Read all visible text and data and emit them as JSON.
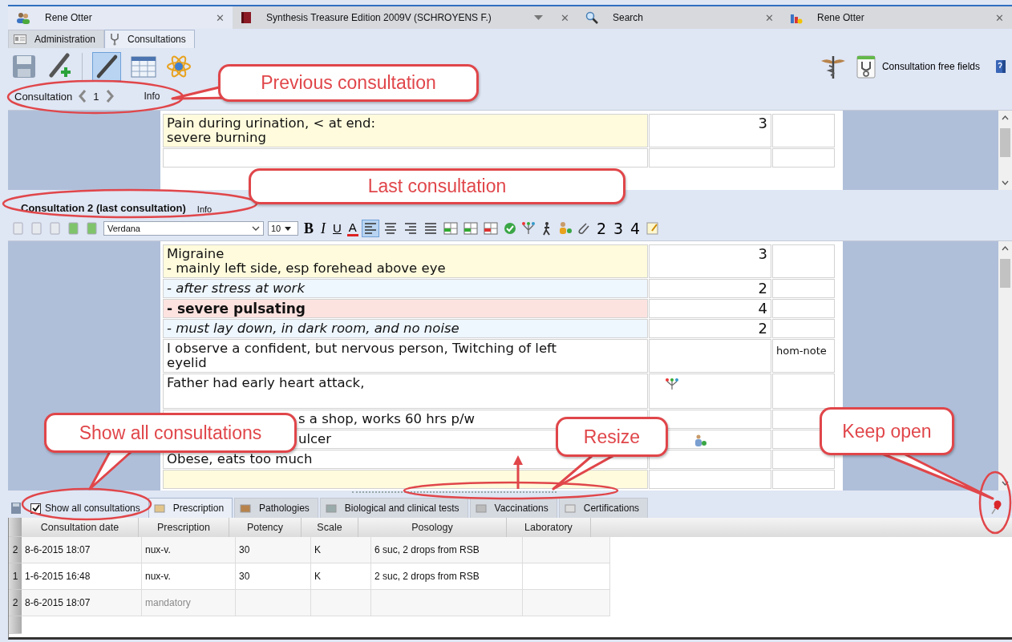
{
  "document_tabs": [
    {
      "title": "Rene Otter",
      "close": "✕",
      "selected": true,
      "has_menu": false
    },
    {
      "title": "Synthesis Treasure Edition 2009V (SCHROYENS F.)",
      "close": "✕",
      "selected": false,
      "has_menu": true
    },
    {
      "title": "Search",
      "close": "✕",
      "selected": false,
      "has_menu": false
    },
    {
      "title": "Rene Otter",
      "close": "✕",
      "selected": false,
      "has_menu": false
    }
  ],
  "record_tabs": [
    {
      "label": "Administration",
      "selected": false
    },
    {
      "label": "Consultations",
      "selected": true
    }
  ],
  "toolbar": {
    "free_fields": "Consultation free fields"
  },
  "navigator": {
    "label": "Consultation",
    "number": "1",
    "info": "Info"
  },
  "previous_consultation": {
    "rows": [
      {
        "lines": [
          "Pain during urination, < at end:",
          "severe burning"
        ],
        "weight": "3",
        "color": "#fffbdc"
      },
      {
        "color": "#ffffff"
      }
    ]
  },
  "last_consultation": {
    "title": "Consultation 2 (last consultation)",
    "info": "Info",
    "font": "Verdana",
    "size": "10",
    "format_buttons": [
      "B",
      "I",
      "U",
      "A"
    ],
    "number_buttons": [
      "2",
      "3",
      "4"
    ],
    "rows": [
      {
        "lines": [
          "Migraine",
          "- mainly left side, esp forehead above eye"
        ],
        "weight": "3",
        "color": "#fffbdc",
        "kind": "normal"
      },
      {
        "lines": [
          "- after stress at work"
        ],
        "weight": "2",
        "color": "#eef6fe",
        "kind": "italic"
      },
      {
        "lines": [
          "- severe pulsating"
        ],
        "weight": "4",
        "color": "#fde3e0",
        "kind": "bold"
      },
      {
        "lines": [
          "- must lay down, in dark room, and no noise"
        ],
        "weight": "2",
        "color": "#eef6fe",
        "kind": "italic"
      },
      {
        "lines": [
          "I observe a confident, but nervous person, Twitching of left",
          "eyelid"
        ],
        "note": "hom-note",
        "color": "#ffffff",
        "kind": "normal"
      },
      {
        "lines": [
          "Father had early heart attack,"
        ],
        "color": "#ffffff",
        "kind": "tree"
      },
      {
        "lines": [
          "s a shop, works 60 hrs p/w"
        ],
        "color": "#ffffff",
        "kind": "covered"
      },
      {
        "lines": [
          "ulcer"
        ],
        "color": "#ffffff",
        "kind": "remedy"
      },
      {
        "lines": [
          "Obese, eats too much"
        ],
        "color": "#ffffff",
        "kind": "normal"
      },
      {
        "color": "#fffbdc",
        "kind": "normal"
      }
    ]
  },
  "bottom_panel": {
    "show_all": {
      "label": "Show all consultations",
      "checked": true
    },
    "tabs": [
      {
        "label": "Prescription",
        "selected": true
      },
      {
        "label": "Pathologies",
        "selected": false
      },
      {
        "label": "Biological and clinical tests",
        "selected": false
      },
      {
        "label": "Vaccinations",
        "selected": false
      },
      {
        "label": "Certifications",
        "selected": false
      }
    ],
    "table": {
      "columns": [
        "Consultation date",
        "Prescription",
        "Potency",
        "Scale",
        "Posology",
        "Laboratory"
      ],
      "rows": [
        {
          "number": "2",
          "date": "8-6-2015 18:07",
          "prescription": "nux-v.",
          "potency": "30",
          "scale": "K",
          "posology": "6 suc, 2 drops from RSB",
          "hint": false
        },
        {
          "number": "1",
          "date": "1-6-2015 16:48",
          "prescription": "nux-v.",
          "potency": "30",
          "scale": "K",
          "posology": "2 suc, 2 drops from RSB",
          "hint": false
        },
        {
          "number": "2",
          "date": "8-6-2015 18:07",
          "prescription": "mandatory",
          "hint": true
        }
      ]
    }
  },
  "callouts": [
    {
      "text": "Previous consultation"
    },
    {
      "text": "Last consultation"
    },
    {
      "text": "Show all consultations"
    },
    {
      "text": "Resize"
    },
    {
      "text": "Keep open"
    }
  ]
}
